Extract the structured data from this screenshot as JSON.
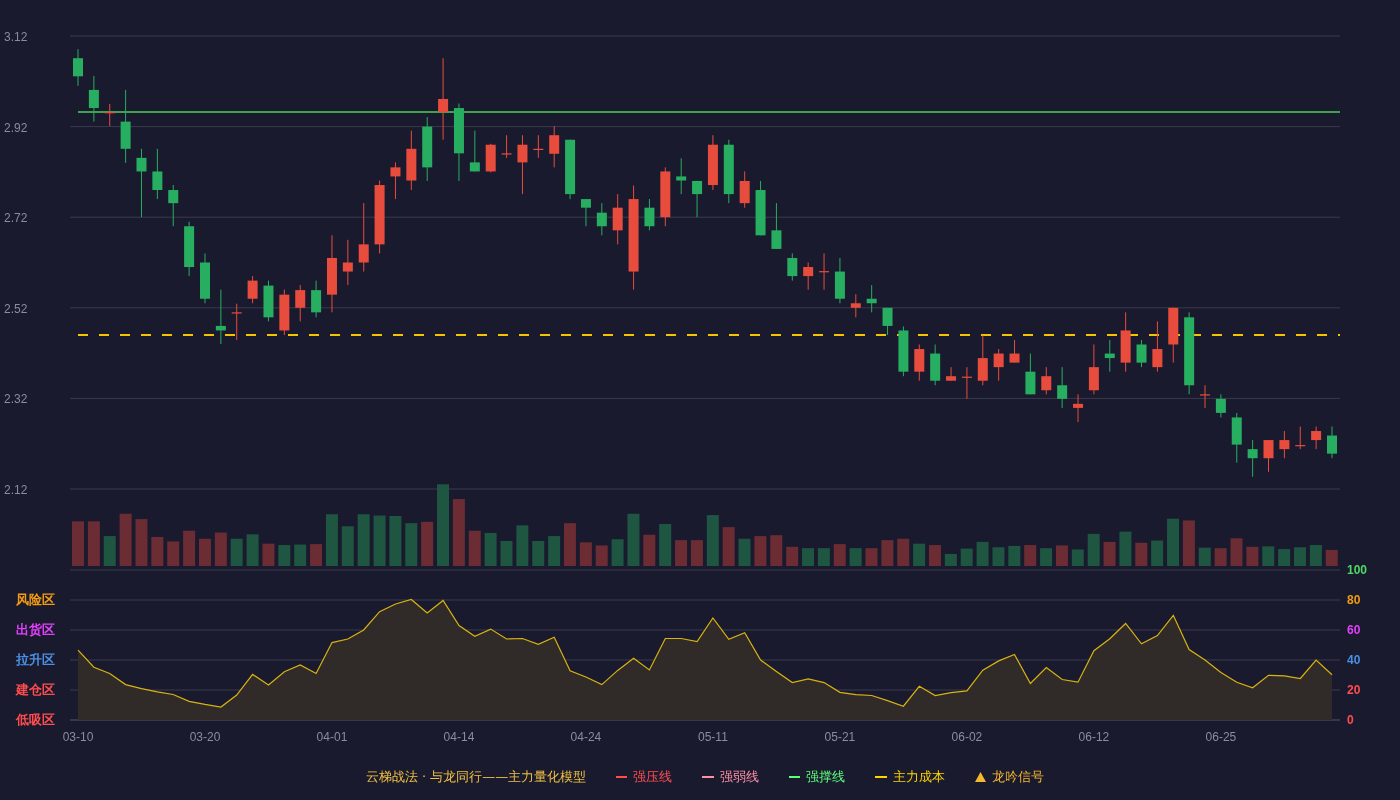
{
  "price_chart": {
    "chart_data": {
      "type": "candlestick",
      "grid": true,
      "ylim": [
        2.12,
        3.12
      ],
      "yticks": [
        {
          "value": 3.12,
          "label": "3.12"
        },
        {
          "value": 2.92,
          "label": "2.92"
        },
        {
          "value": 2.72,
          "label": "2.72"
        },
        {
          "value": 2.52,
          "label": "2.52"
        },
        {
          "value": 2.32,
          "label": "2.32"
        },
        {
          "value": 2.12,
          "label": "2.12"
        }
      ],
      "categories": [
        null,
        null,
        null,
        null,
        null,
        null,
        null,
        null,
        null,
        null,
        null,
        null,
        null,
        null,
        null,
        null,
        null,
        null,
        null,
        null,
        null,
        null,
        null,
        null,
        null,
        null,
        null,
        null,
        null,
        null,
        null,
        null,
        null,
        null,
        null,
        null,
        null,
        null,
        null,
        null,
        null,
        null,
        null,
        null,
        null,
        null,
        null,
        null,
        null,
        null,
        null,
        null,
        null,
        null,
        null,
        null,
        null,
        null,
        null,
        null,
        null,
        null,
        null,
        null,
        null,
        null,
        null,
        null,
        null,
        null,
        null,
        null,
        null,
        null,
        null,
        null,
        null,
        null,
        null,
        null
      ],
      "ohlc": [
        [
          3.071,
          3.091,
          3.01,
          3.031
        ],
        [
          3.001,
          3.032,
          2.931,
          2.961
        ],
        [
          2.951,
          2.97,
          2.921,
          2.952
        ],
        [
          2.931,
          3.001,
          2.84,
          2.871
        ],
        [
          2.851,
          2.871,
          2.72,
          2.821
        ],
        [
          2.821,
          2.871,
          2.76,
          2.78
        ],
        [
          2.78,
          2.791,
          2.7,
          2.751
        ],
        [
          2.7,
          2.71,
          2.59,
          2.61
        ],
        [
          2.62,
          2.64,
          2.53,
          2.54
        ],
        [
          2.48,
          2.56,
          2.44,
          2.47
        ],
        [
          2.509,
          2.529,
          2.449,
          2.51
        ],
        [
          2.54,
          2.59,
          2.53,
          2.58
        ],
        [
          2.569,
          2.58,
          2.49,
          2.499
        ],
        [
          2.47,
          2.56,
          2.46,
          2.549
        ],
        [
          2.52,
          2.57,
          2.49,
          2.559
        ],
        [
          2.559,
          2.58,
          2.499,
          2.51
        ],
        [
          2.549,
          2.68,
          2.51,
          2.63
        ],
        [
          2.6,
          2.67,
          2.57,
          2.62
        ],
        [
          2.62,
          2.751,
          2.6,
          2.66
        ],
        [
          2.66,
          2.801,
          2.64,
          2.791
        ],
        [
          2.81,
          2.841,
          2.76,
          2.83
        ],
        [
          2.801,
          2.911,
          2.78,
          2.871
        ],
        [
          2.92,
          2.941,
          2.8,
          2.83
        ],
        [
          2.952,
          3.071,
          2.891,
          2.981
        ],
        [
          2.961,
          2.971,
          2.8,
          2.861
        ],
        [
          2.841,
          2.911,
          2.821,
          2.821
        ],
        [
          2.821,
          2.882,
          2.819,
          2.88
        ],
        [
          2.86,
          2.901,
          2.851,
          2.861
        ],
        [
          2.841,
          2.901,
          2.771,
          2.88
        ],
        [
          2.87,
          2.901,
          2.851,
          2.871
        ],
        [
          2.86,
          2.921,
          2.83,
          2.901
        ],
        [
          2.891,
          2.891,
          2.76,
          2.771
        ],
        [
          2.76,
          2.76,
          2.7,
          2.741
        ],
        [
          2.73,
          2.751,
          2.68,
          2.7
        ],
        [
          2.691,
          2.771,
          2.66,
          2.741
        ],
        [
          2.6,
          2.79,
          2.56,
          2.76
        ],
        [
          2.741,
          2.76,
          2.691,
          2.7
        ],
        [
          2.72,
          2.83,
          2.7,
          2.821
        ],
        [
          2.81,
          2.85,
          2.771,
          2.801
        ],
        [
          2.8,
          2.8,
          2.72,
          2.771
        ],
        [
          2.791,
          2.901,
          2.78,
          2.88
        ],
        [
          2.88,
          2.891,
          2.751,
          2.771
        ],
        [
          2.751,
          2.821,
          2.741,
          2.8
        ],
        [
          2.78,
          2.8,
          2.68,
          2.68
        ],
        [
          2.691,
          2.751,
          2.65,
          2.65
        ],
        [
          2.63,
          2.64,
          2.58,
          2.59
        ],
        [
          2.59,
          2.62,
          2.56,
          2.61
        ],
        [
          2.6,
          2.64,
          2.56,
          2.601
        ],
        [
          2.6,
          2.63,
          2.53,
          2.54
        ],
        [
          2.52,
          2.55,
          2.499,
          2.53
        ],
        [
          2.54,
          2.57,
          2.51,
          2.53
        ],
        [
          2.52,
          2.52,
          2.46,
          2.48
        ],
        [
          2.47,
          2.479,
          2.369,
          2.379
        ],
        [
          2.379,
          2.439,
          2.359,
          2.429
        ],
        [
          2.419,
          2.439,
          2.349,
          2.359
        ],
        [
          2.359,
          2.389,
          2.359,
          2.369
        ],
        [
          2.367,
          2.389,
          2.319,
          2.368
        ],
        [
          2.359,
          2.459,
          2.349,
          2.409
        ],
        [
          2.389,
          2.429,
          2.359,
          2.419
        ],
        [
          2.399,
          2.449,
          2.399,
          2.419
        ],
        [
          2.379,
          2.419,
          2.329,
          2.329
        ],
        [
          2.338,
          2.389,
          2.329,
          2.369
        ],
        [
          2.349,
          2.389,
          2.299,
          2.319
        ],
        [
          2.299,
          2.329,
          2.268,
          2.308
        ],
        [
          2.338,
          2.439,
          2.329,
          2.389
        ],
        [
          2.419,
          2.449,
          2.379,
          2.409
        ],
        [
          2.399,
          2.51,
          2.379,
          2.47
        ],
        [
          2.439,
          2.449,
          2.389,
          2.399
        ],
        [
          2.389,
          2.49,
          2.379,
          2.429
        ],
        [
          2.439,
          2.52,
          2.399,
          2.52
        ],
        [
          2.499,
          2.51,
          2.329,
          2.349
        ],
        [
          2.328,
          2.349,
          2.299,
          2.329
        ],
        [
          2.319,
          2.329,
          2.278,
          2.288
        ],
        [
          2.278,
          2.288,
          2.178,
          2.218
        ],
        [
          2.208,
          2.228,
          2.147,
          2.188
        ],
        [
          2.188,
          2.228,
          2.158,
          2.228
        ],
        [
          2.208,
          2.248,
          2.188,
          2.228
        ],
        [
          2.216,
          2.258,
          2.208,
          2.217
        ],
        [
          2.228,
          2.258,
          2.208,
          2.248
        ],
        [
          2.238,
          2.258,
          2.188,
          2.198
        ]
      ],
      "ref_lines": [
        {
          "axis": "y",
          "value": 2.952,
          "color": "#3fa34d"
        },
        {
          "axis": "y",
          "value": 2.46,
          "color": "#f5c400"
        }
      ]
    },
    "ref_line_kinds": [
      {
        "kind": "solid"
      },
      {
        "kind": "dashed"
      }
    ]
  },
  "indicator": {
    "zones": [
      {
        "label": "风险区",
        "color": "#f39c12"
      },
      {
        "label": "出货区",
        "color": "#e040fb"
      },
      {
        "label": "拉升区",
        "color": "#4a90e2"
      },
      {
        "label": "建仓区",
        "color": "#ff4d4f"
      },
      {
        "label": "低吸区",
        "color": "#ff4d4f"
      }
    ],
    "tick_colors": [
      {
        "color": "#4cd964"
      },
      {
        "color": "#f39c12"
      },
      {
        "color": "#e040fb"
      },
      {
        "color": "#4a90e2"
      },
      {
        "color": "#ff4d4f"
      },
      {
        "color": "#ff4d4f"
      }
    ],
    "chart_data": {
      "type": "area",
      "grid": true,
      "ylim": [
        0,
        100
      ],
      "yticks": [
        {
          "value": 100,
          "label": "100"
        },
        {
          "value": 80,
          "label": "80"
        },
        {
          "value": 60,
          "label": "60"
        },
        {
          "value": 40,
          "label": "40"
        },
        {
          "value": 20,
          "label": "20"
        },
        {
          "value": 0,
          "label": "0"
        }
      ],
      "categories": [
        "03-10",
        null,
        null,
        null,
        null,
        null,
        null,
        null,
        "03-20",
        null,
        null,
        null,
        null,
        null,
        null,
        null,
        "04-01",
        null,
        null,
        null,
        null,
        null,
        null,
        null,
        "04-14",
        null,
        null,
        null,
        null,
        null,
        null,
        null,
        "04-24",
        null,
        null,
        null,
        null,
        null,
        null,
        null,
        "05-11",
        null,
        null,
        null,
        null,
        null,
        null,
        null,
        "05-21",
        null,
        null,
        null,
        null,
        null,
        null,
        null,
        "06-02",
        null,
        null,
        null,
        null,
        null,
        null,
        null,
        "06-12",
        null,
        null,
        null,
        null,
        null,
        null,
        null,
        "06-25",
        null,
        null,
        null,
        null,
        null,
        null,
        null
      ],
      "series": [
        {
          "color": "#d9b310",
          "values": [
            46.6,
            35.2,
            31,
            23.6,
            20.9,
            18.8,
            17,
            12.5,
            10.4,
            8.7,
            16.7,
            30.4,
            23.3,
            32.2,
            36.7,
            31,
            51.6,
            54,
            60,
            72.2,
            77.3,
            80.3,
            71.3,
            79.7,
            63,
            55.8,
            60.6,
            54,
            54.3,
            50.4,
            55.2,
            32.8,
            28.7,
            23.6,
            33.1,
            41.2,
            33.4,
            54.3,
            54.3,
            52.3,
            68,
            53.8,
            58.2,
            40,
            32.3,
            24.9,
            27.4,
            24.9,
            18.5,
            16.9,
            16.3,
            12.9,
            9.2,
            22.5,
            16.3,
            18.2,
            19.4,
            33.2,
            39.4,
            43.7,
            24.3,
            35,
            27,
            25.2,
            46.2,
            54.2,
            64.3,
            50.8,
            56.3,
            69.8,
            47,
            40,
            31.7,
            25.2,
            21.5,
            29.8,
            29.5,
            27.7,
            40,
            30.2
          ]
        }
      ]
    }
  },
  "legend": {
    "title": "云梯战法 · 与龙同行——主力量化模型",
    "items": [
      {
        "label": "强压线",
        "kind": "solid",
        "color": "#ff4d4f"
      },
      {
        "label": "强弱线",
        "kind": "dashed",
        "color": "#ff8fa3"
      },
      {
        "label": "强撑线",
        "kind": "solid",
        "color": "#5cff7a"
      },
      {
        "label": "主力成本",
        "kind": "dashed",
        "color": "#ffd400"
      },
      {
        "label": "龙吟信号",
        "kind": "triangle",
        "color": "#f5b82e"
      }
    ]
  }
}
